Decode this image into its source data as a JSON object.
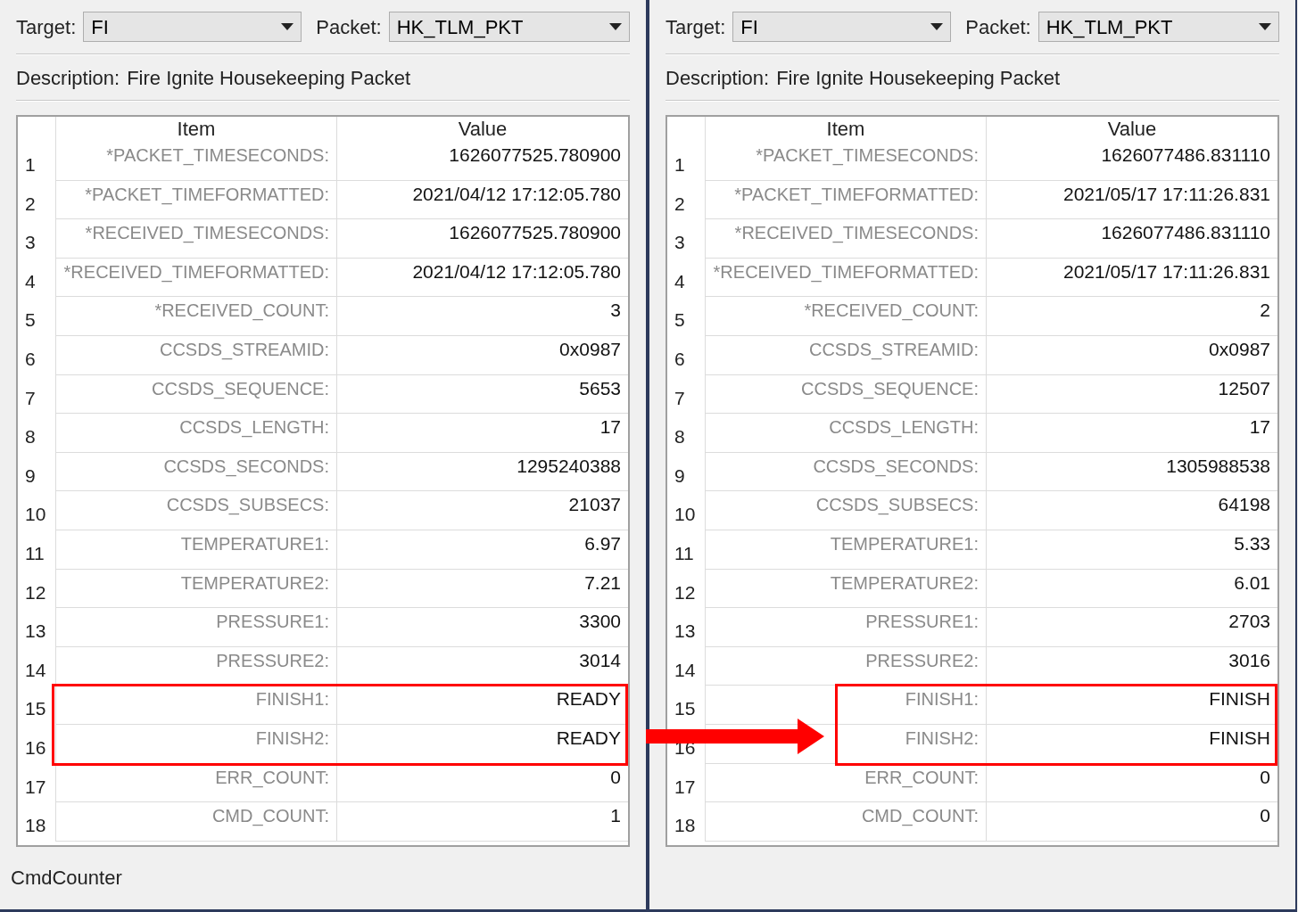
{
  "panels": [
    {
      "target_label": "Target:",
      "target": "FI",
      "packet_label": "Packet:",
      "packet": "HK_TLM_PKT",
      "description_label": "Description:",
      "description": "Fire Ignite Housekeeping Packet",
      "columns": [
        "Item",
        "Value"
      ],
      "rows": [
        {
          "number": "1",
          "item": "*PACKET_TIMESECONDS:",
          "value": "1626077525.780900",
          "highlighted": false
        },
        {
          "number": "2",
          "item": "*PACKET_TIMEFORMATTED:",
          "value": "2021/04/12 17:12:05.780",
          "highlighted": false
        },
        {
          "number": "3",
          "item": "*RECEIVED_TIMESECONDS:",
          "value": "1626077525.780900",
          "highlighted": false
        },
        {
          "number": "4",
          "item": "*RECEIVED_TIMEFORMATTED:",
          "value": "2021/04/12 17:12:05.780",
          "highlighted": false
        },
        {
          "number": "5",
          "item": "*RECEIVED_COUNT:",
          "value": "3",
          "highlighted": false
        },
        {
          "number": "6",
          "item": "CCSDS_STREAMID:",
          "value": "0x0987",
          "highlighted": false
        },
        {
          "number": "7",
          "item": "CCSDS_SEQUENCE:",
          "value": "5653",
          "highlighted": false
        },
        {
          "number": "8",
          "item": "CCSDS_LENGTH:",
          "value": "17",
          "highlighted": false
        },
        {
          "number": "9",
          "item": "CCSDS_SECONDS:",
          "value": "1295240388",
          "highlighted": false
        },
        {
          "number": "10",
          "item": "CCSDS_SUBSECS:",
          "value": "21037",
          "highlighted": false
        },
        {
          "number": "11",
          "item": "TEMPERATURE1:",
          "value": "6.97",
          "highlighted": false
        },
        {
          "number": "12",
          "item": "TEMPERATURE2:",
          "value": "7.21",
          "highlighted": false
        },
        {
          "number": "13",
          "item": "PRESSURE1:",
          "value": "3300",
          "highlighted": false
        },
        {
          "number": "14",
          "item": "PRESSURE2:",
          "value": "3014",
          "highlighted": false
        },
        {
          "number": "15",
          "item": "FINISH1:",
          "value": "READY",
          "highlighted": true
        },
        {
          "number": "16",
          "item": "FINISH2:",
          "value": "READY",
          "highlighted": true
        },
        {
          "number": "17",
          "item": "ERR_COUNT:",
          "value": "0",
          "highlighted": false
        },
        {
          "number": "18",
          "item": "CMD_COUNT:",
          "value": "1",
          "highlighted": false
        }
      ],
      "status": "CmdCounter"
    },
    {
      "target_label": "Target:",
      "target": "FI",
      "packet_label": "Packet:",
      "packet": "HK_TLM_PKT",
      "description_label": "Description:",
      "description": "Fire Ignite Housekeeping Packet",
      "columns": [
        "Item",
        "Value"
      ],
      "rows": [
        {
          "number": "1",
          "item": "*PACKET_TIMESECONDS:",
          "value": "1626077486.831110",
          "highlighted": false
        },
        {
          "number": "2",
          "item": "*PACKET_TIMEFORMATTED:",
          "value": "2021/05/17 17:11:26.831",
          "highlighted": false
        },
        {
          "number": "3",
          "item": "*RECEIVED_TIMESECONDS:",
          "value": "1626077486.831110",
          "highlighted": false
        },
        {
          "number": "4",
          "item": "*RECEIVED_TIMEFORMATTED:",
          "value": "2021/05/17 17:11:26.831",
          "highlighted": false
        },
        {
          "number": "5",
          "item": "*RECEIVED_COUNT:",
          "value": "2",
          "highlighted": false
        },
        {
          "number": "6",
          "item": "CCSDS_STREAMID:",
          "value": "0x0987",
          "highlighted": false
        },
        {
          "number": "7",
          "item": "CCSDS_SEQUENCE:",
          "value": "12507",
          "highlighted": false
        },
        {
          "number": "8",
          "item": "CCSDS_LENGTH:",
          "value": "17",
          "highlighted": false
        },
        {
          "number": "9",
          "item": "CCSDS_SECONDS:",
          "value": "1305988538",
          "highlighted": false
        },
        {
          "number": "10",
          "item": "CCSDS_SUBSECS:",
          "value": "64198",
          "highlighted": false
        },
        {
          "number": "11",
          "item": "TEMPERATURE1:",
          "value": "5.33",
          "highlighted": false
        },
        {
          "number": "12",
          "item": "TEMPERATURE2:",
          "value": "6.01",
          "highlighted": false
        },
        {
          "number": "13",
          "item": "PRESSURE1:",
          "value": "2703",
          "highlighted": false
        },
        {
          "number": "14",
          "item": "PRESSURE2:",
          "value": "3016",
          "highlighted": false
        },
        {
          "number": "15",
          "item": "FINISH1:",
          "value": "FINISH",
          "highlighted": true
        },
        {
          "number": "16",
          "item": "FINISH2:",
          "value": "FINISH",
          "highlighted": true
        },
        {
          "number": "17",
          "item": "ERR_COUNT:",
          "value": "0",
          "highlighted": false
        },
        {
          "number": "18",
          "item": "CMD_COUNT:",
          "value": "0",
          "highlighted": false
        }
      ]
    }
  ]
}
